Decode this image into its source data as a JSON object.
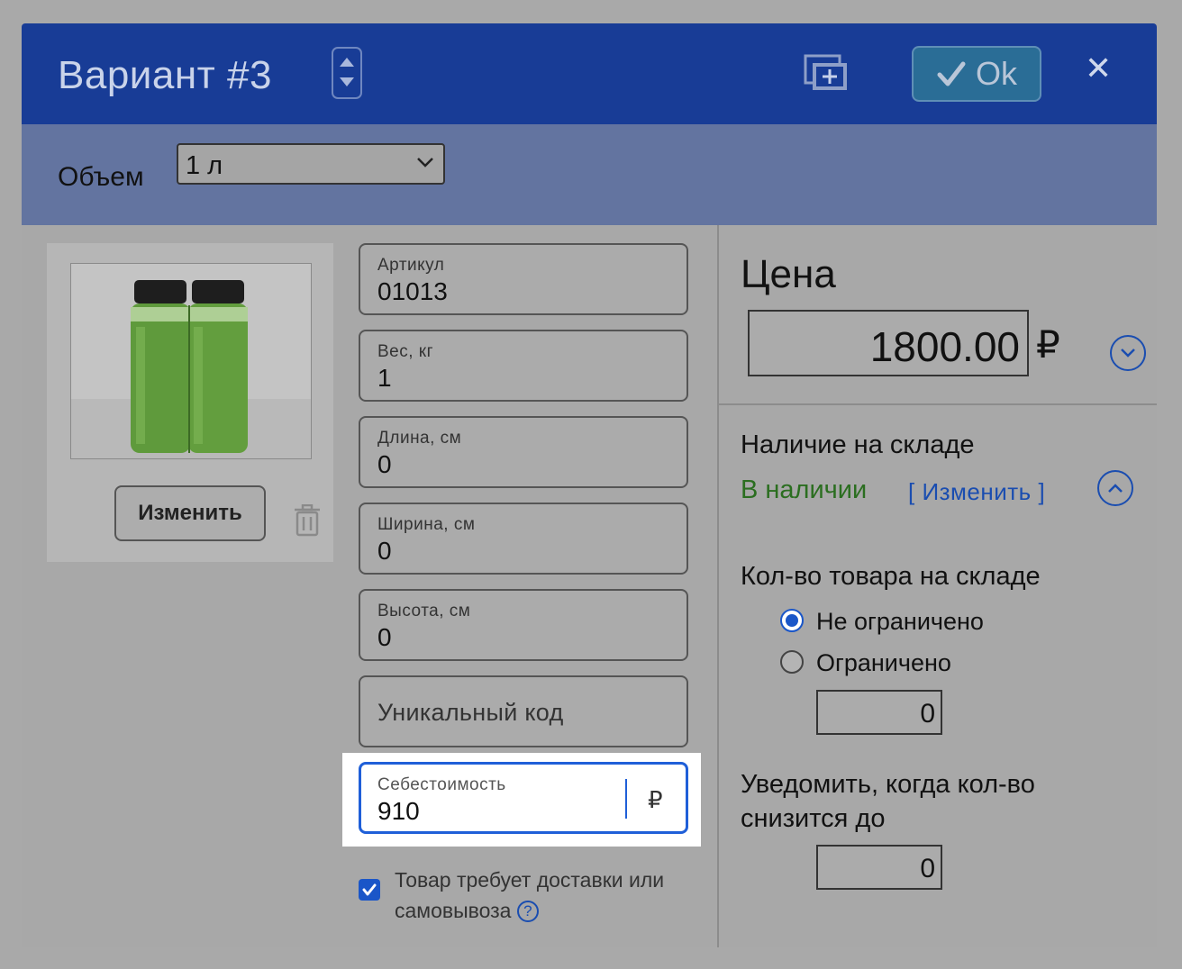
{
  "header": {
    "title": "Вариант #3",
    "ok_label": "Ok",
    "close_label": "✕"
  },
  "volume": {
    "label": "Объем",
    "selected": "1 л"
  },
  "photo_panel": {
    "change_label": "Изменить"
  },
  "fields": {
    "sku": {
      "label": "Артикул",
      "value": "01013"
    },
    "weight": {
      "label": "Вес, кг",
      "value": "1"
    },
    "length": {
      "label": "Длина, см",
      "value": "0"
    },
    "width": {
      "label": "Ширина, см",
      "value": "0"
    },
    "height": {
      "label": "Высота, см",
      "value": "0"
    },
    "unique_code": {
      "placeholder": "Уникальный код"
    },
    "cost": {
      "label": "Себестоимость",
      "value": "910",
      "currency": "₽"
    }
  },
  "delivery": {
    "checked": true,
    "label": "Товар требует доставки или самовывоза",
    "help": "?"
  },
  "price": {
    "title": "Цена",
    "value": "1800.00",
    "currency": "₽"
  },
  "stock": {
    "title": "Наличие на складе",
    "status": "В наличии",
    "change_label": "[ Изменить ]",
    "qty_title": "Кол-во товара на складе",
    "options": [
      {
        "label": "Не ограничено",
        "selected": true
      },
      {
        "label": "Ограничено",
        "selected": false
      }
    ],
    "limited_qty": "0",
    "notify_title": "Уведомить, когда кол-во снизится до",
    "notify_qty": "0"
  },
  "colors": {
    "header_bg": "#183c96",
    "volume_bar_bg": "#6374a0",
    "accent": "#1a4db0",
    "in_stock": "#2b6e20",
    "focus_border": "#1f5fd8"
  }
}
